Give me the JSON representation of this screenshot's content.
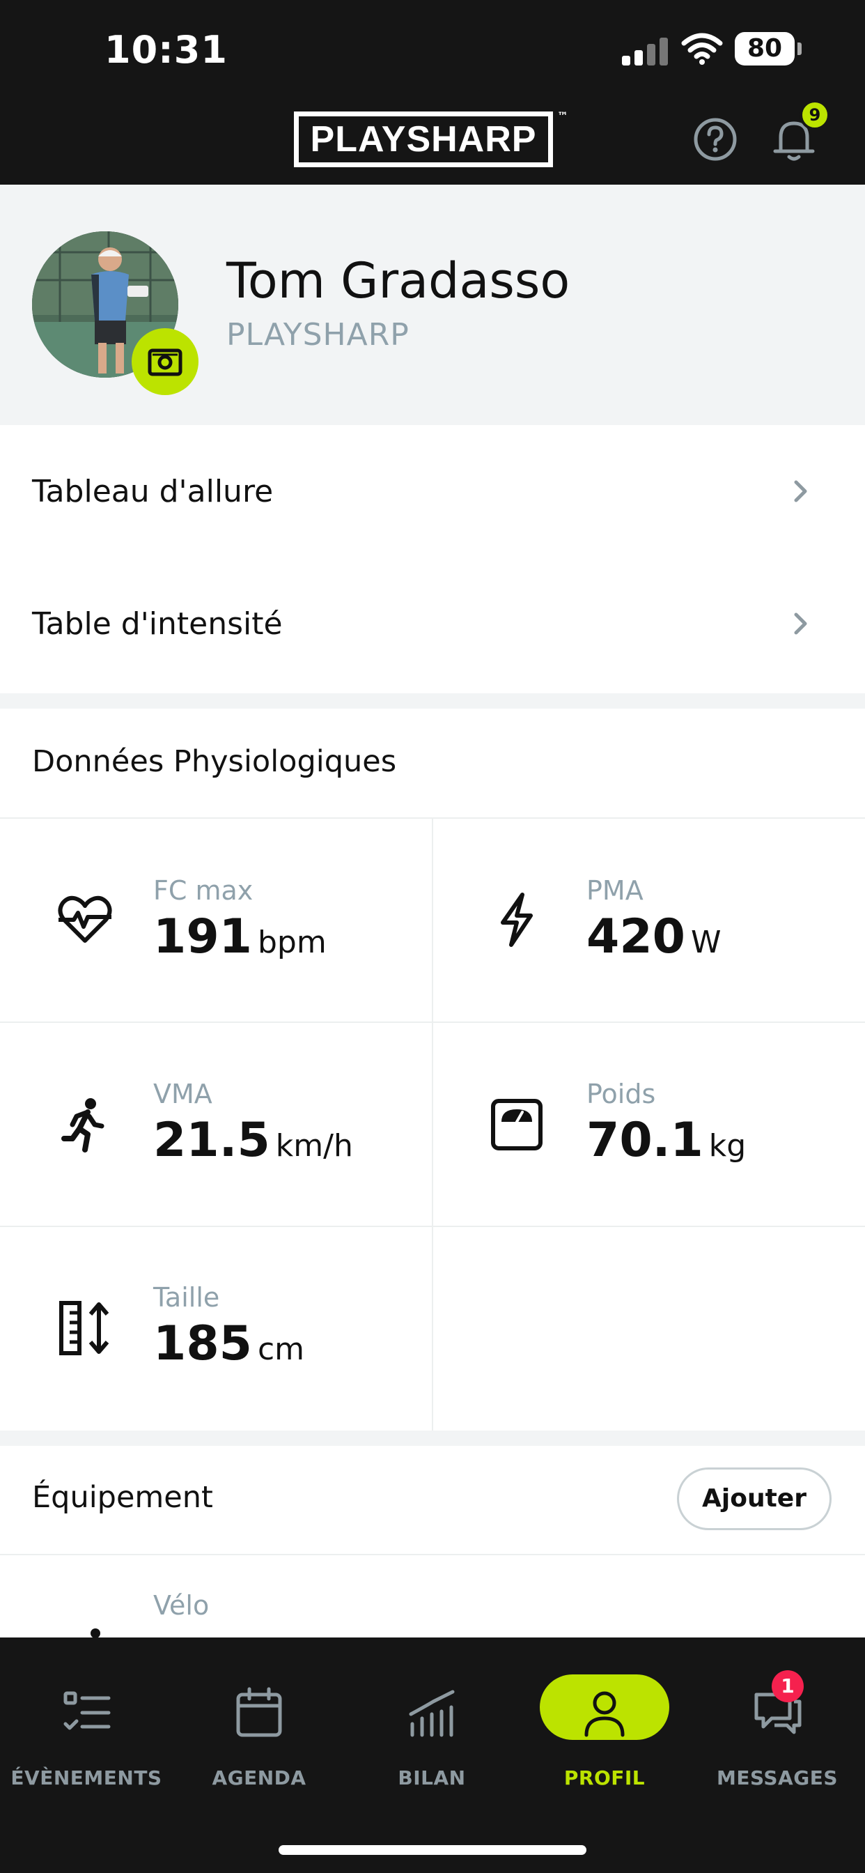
{
  "status_bar": {
    "time": "10:31",
    "battery": "80"
  },
  "header": {
    "logo_text": "PLAYSHARP",
    "trademark": "™",
    "notification_count": "9",
    "accent_color": "#bce300"
  },
  "profile": {
    "name": "Tom Gradasso",
    "organization": "PLAYSHARP"
  },
  "menu": [
    {
      "label": "Tableau d'allure"
    },
    {
      "label": "Table d'intensité"
    }
  ],
  "physio": {
    "title": "Données Physiologiques",
    "items": [
      {
        "label": "FC max",
        "value": "191",
        "unit": "bpm",
        "icon": "heart-rate-icon"
      },
      {
        "label": "PMA",
        "value": "420",
        "unit": "W",
        "icon": "lightning-icon"
      },
      {
        "label": "VMA",
        "value": "21.5",
        "unit": "km/h",
        "icon": "runner-icon"
      },
      {
        "label": "Poids",
        "value": "70.1",
        "unit": "kg",
        "icon": "scale-icon"
      },
      {
        "label": "Taille",
        "value": "185",
        "unit": "cm",
        "icon": "height-ruler-icon"
      }
    ]
  },
  "equipment": {
    "title": "Équipement",
    "add_label": "Ajouter",
    "first_item_label": "Vélo"
  },
  "nav": {
    "items": [
      {
        "label": "ÉVÈNEMENTS",
        "icon": "checklist-icon",
        "active": false
      },
      {
        "label": "AGENDA",
        "icon": "calendar-icon",
        "active": false
      },
      {
        "label": "BILAN",
        "icon": "chart-icon",
        "active": false
      },
      {
        "label": "PROFIL",
        "icon": "person-icon",
        "active": true
      },
      {
        "label": "MESSAGES",
        "icon": "chat-icon",
        "active": false
      }
    ],
    "messages_badge": "1"
  }
}
